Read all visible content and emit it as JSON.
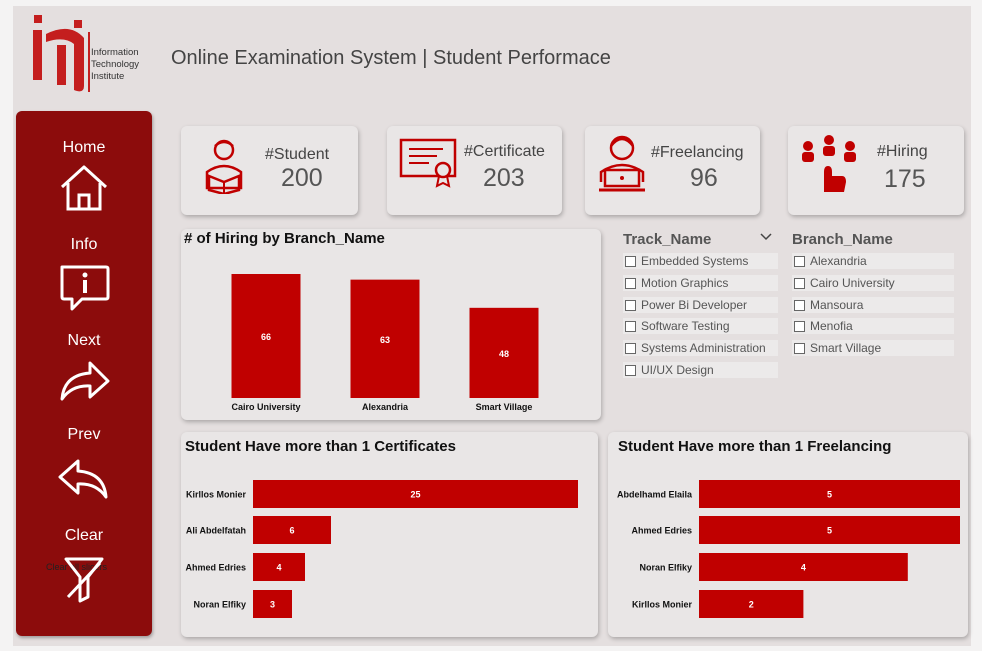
{
  "header": {
    "logo_mark": "iti",
    "logo_lines": [
      "Information",
      "Technology",
      "Institute"
    ],
    "title": "Online Examination System | Student Performace"
  },
  "sidebar": {
    "items": [
      {
        "label": "Home",
        "icon": "home-icon"
      },
      {
        "label": "Info",
        "icon": "info-icon"
      },
      {
        "label": "Next",
        "icon": "forward-arrow-icon"
      },
      {
        "label": "Prev",
        "icon": "back-arrow-icon"
      },
      {
        "label": "Clear",
        "icon": "clear-filter-icon",
        "tooltip": "Clear all slicers"
      }
    ]
  },
  "kpis": [
    {
      "label": "#Student",
      "value": "200",
      "icon": "student-reading-icon"
    },
    {
      "label": "#Certificate",
      "value": "203",
      "icon": "certificate-icon"
    },
    {
      "label": "#Freelancing",
      "value": "96",
      "icon": "freelancer-laptop-icon"
    },
    {
      "label": "#Hiring",
      "value": "175",
      "icon": "hiring-icon"
    }
  ],
  "colors": {
    "accent": "#c00000",
    "sidebar": "#8c0c0c",
    "background": "#e4dfdf"
  },
  "hiring_chart": {
    "title": "# of Hiring by Branch_Name"
  },
  "slicers": {
    "track": {
      "title": "Track_Name",
      "items": [
        "Embedded Systems",
        "Motion Graphics",
        "Power Bi Developer",
        "Software Testing",
        "Systems Administration",
        "UI/UX Design"
      ]
    },
    "branch": {
      "title": "Branch_Name",
      "items": [
        "Alexandria",
        "Cairo University",
        "Mansoura",
        "Menofia",
        "Smart Village"
      ]
    }
  },
  "cert_chart": {
    "title": "Student Have more than 1 Certificates"
  },
  "free_chart": {
    "title": "Student Have more than 1 Freelancing"
  },
  "chart_data": [
    {
      "type": "bar",
      "title": "# of Hiring by Branch_Name",
      "categories": [
        "Cairo University",
        "Alexandria",
        "Smart Village"
      ],
      "values": [
        66,
        63,
        48
      ],
      "ylim": [
        0,
        66
      ]
    },
    {
      "type": "bar",
      "orientation": "horizontal",
      "title": "Student Have more than 1 Certificates",
      "categories": [
        "Kirllos Monier",
        "Ali Abdelfatah",
        "Ahmed Edries",
        "Noran Elfiky"
      ],
      "values": [
        25,
        6,
        4,
        3
      ],
      "xlim": [
        0,
        25
      ]
    },
    {
      "type": "bar",
      "orientation": "horizontal",
      "title": "Student Have more than 1 Freelancing",
      "categories": [
        "Abdelhamd Elaila",
        "Ahmed Edries",
        "Noran Elfiky",
        "Kirllos Monier"
      ],
      "values": [
        5,
        5,
        4,
        2
      ],
      "xlim": [
        0,
        5
      ]
    }
  ]
}
